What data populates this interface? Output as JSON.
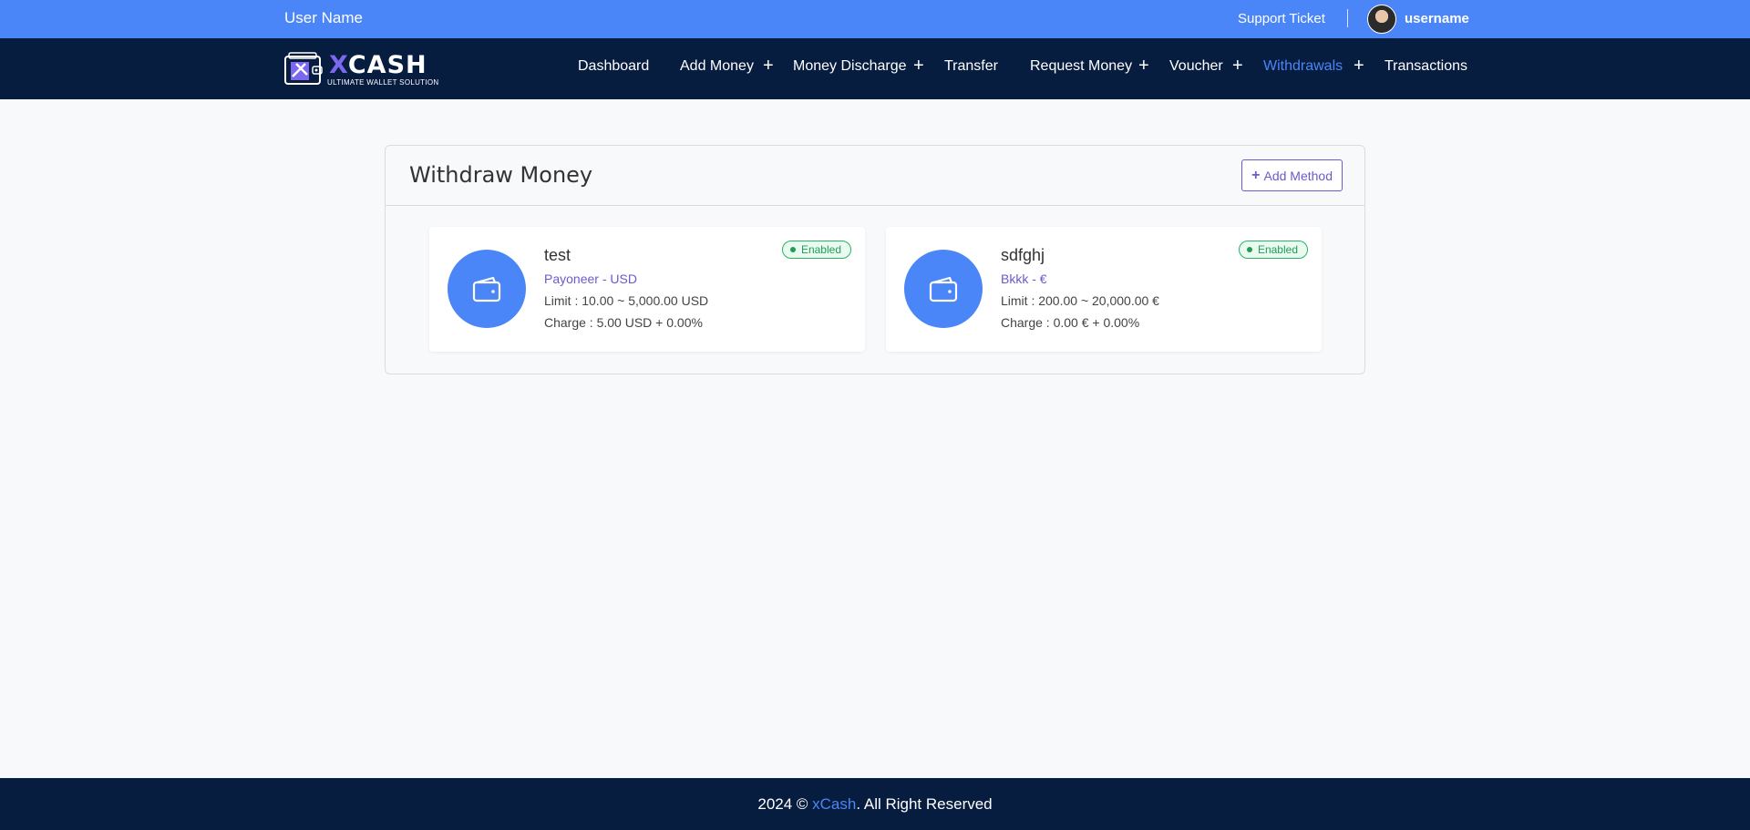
{
  "topbar": {
    "user_name": "User Name",
    "support_label": "Support Ticket",
    "username": "username"
  },
  "logo": {
    "brand_x": "X",
    "brand_rest": "CASH",
    "tagline": "ULTIMATE WALLET SOLUTION"
  },
  "nav": {
    "items": [
      {
        "label": "Dashboard",
        "has_plus": false,
        "active": false
      },
      {
        "label": "Add Money",
        "has_plus": true,
        "active": false
      },
      {
        "label": "Money Discharge",
        "has_plus": true,
        "active": false
      },
      {
        "label": "Transfer",
        "has_plus": false,
        "active": false
      },
      {
        "label": "Request Money",
        "has_plus": true,
        "active": false
      },
      {
        "label": "Voucher",
        "has_plus": true,
        "active": false
      },
      {
        "label": "Withdrawals",
        "has_plus": true,
        "active": true
      },
      {
        "label": "Transactions",
        "has_plus": false,
        "active": false
      }
    ],
    "plus_symbol": "+"
  },
  "page": {
    "title": "Withdraw Money",
    "add_method_label": "Add Method"
  },
  "methods": [
    {
      "name": "test",
      "gateway": "Payoneer - USD",
      "limit": "Limit : 10.00 ~ 5,000.00 USD",
      "charge": "Charge : 5.00 USD + 0.00%",
      "status": "Enabled"
    },
    {
      "name": "sdfghj",
      "gateway": "Bkkk - €",
      "limit": "Limit : 200.00 ~ 20,000.00 €",
      "charge": "Charge : 0.00 € + 0.00%",
      "status": "Enabled"
    }
  ],
  "footer": {
    "prefix": "2024 © ",
    "brand": "xCash",
    "suffix": ". All Right Reserved"
  },
  "colors": {
    "topbar": "#4a86f7",
    "navbar": "#071d3f",
    "accent": "#6a5acd",
    "active_nav": "#4a86f7",
    "status_green": "#1e9e56"
  },
  "icons": {
    "method_icon": "wallet-icon",
    "add_icon": "plus-icon",
    "avatar": "avatar"
  }
}
